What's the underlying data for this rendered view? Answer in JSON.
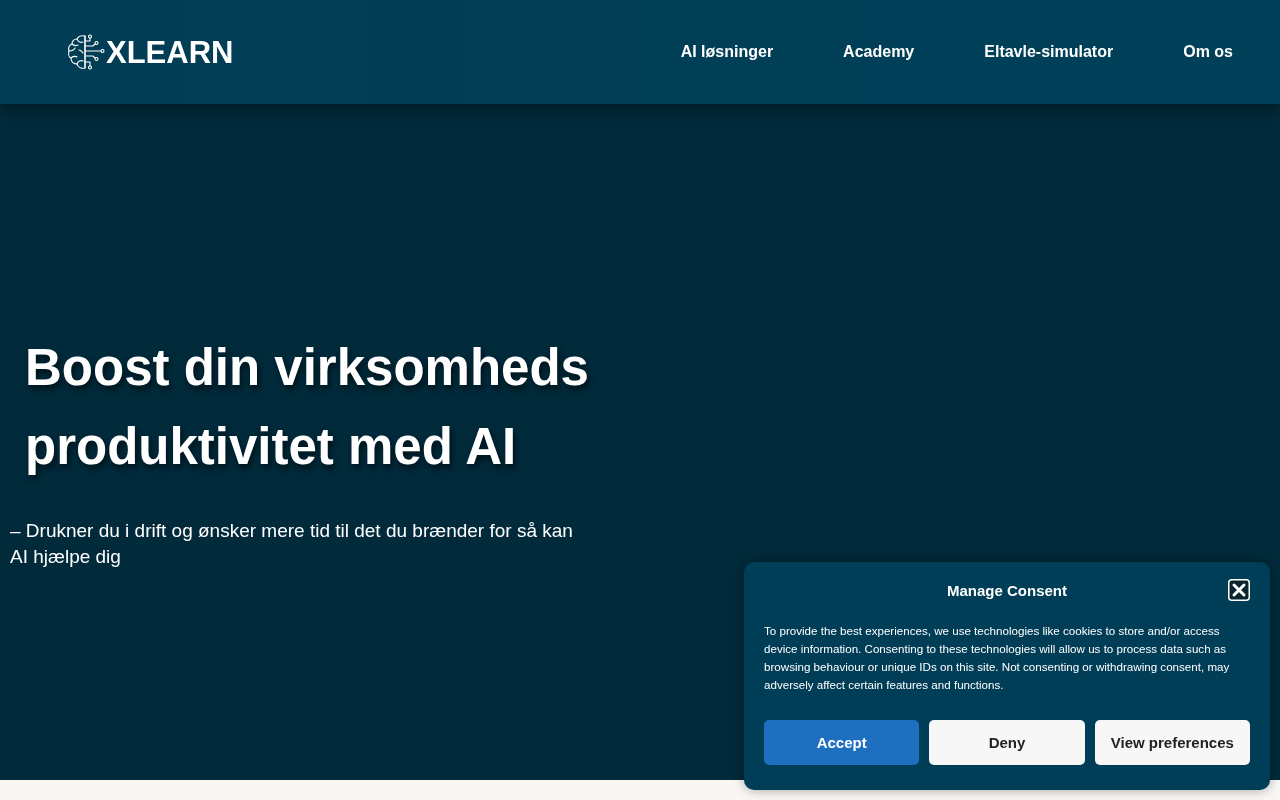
{
  "header": {
    "logo": {
      "text": "XLEARN"
    },
    "nav": [
      {
        "label": "AI løsninger"
      },
      {
        "label": "Academy"
      },
      {
        "label": "Eltavle-simulator"
      },
      {
        "label": "Om os"
      }
    ]
  },
  "hero": {
    "title": "Boost din virksomheds produktivitet med AI",
    "subtitle": "– Drukner du i drift og ønsker mere tid til det du brænder for så kan AI hjælpe dig"
  },
  "consent": {
    "title": "Manage Consent",
    "body": "To provide the best experiences, we use technologies like cookies to store and/or access device information. Consenting to these technologies will allow us to process data such as browsing behaviour or unique IDs on this site. Not consenting or withdrawing consent, may adversely affect certain features and functions.",
    "buttons": [
      {
        "label": "Accept",
        "kind": "primary"
      },
      {
        "label": "Deny",
        "kind": "secondary"
      },
      {
        "label": "View preferences",
        "kind": "secondary"
      }
    ]
  }
}
